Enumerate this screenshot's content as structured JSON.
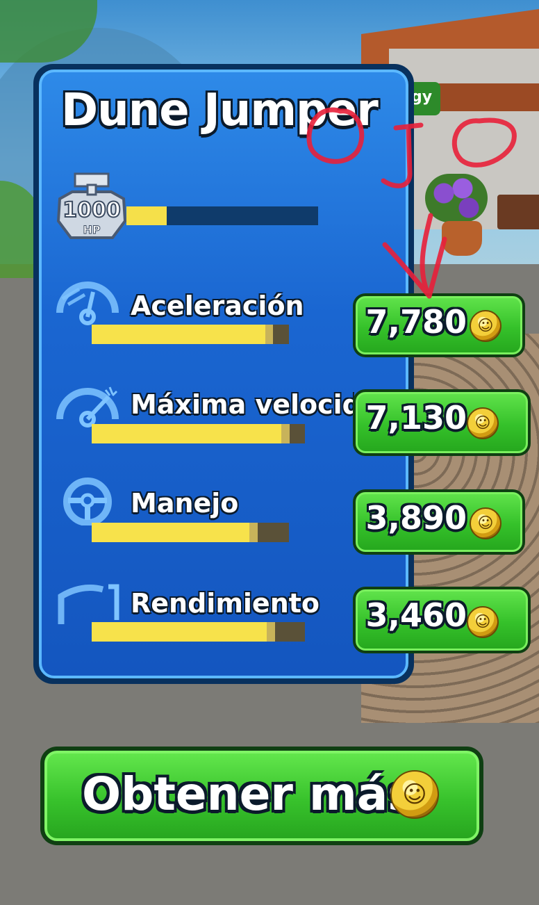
{
  "car": {
    "name": "Dune Jumper",
    "hp_badge": {
      "value": "1000",
      "unit": "HP"
    },
    "hp_progress": 0.21
  },
  "stats": [
    {
      "label": "Aceleración",
      "price": "7,780",
      "current": 0.88,
      "upgrade": 0.04
    },
    {
      "label": "Máxima velocidad",
      "price": "7,130",
      "current": 0.89,
      "upgrade": 0.04
    },
    {
      "label": "Manejo",
      "price": "3,890",
      "current": 0.8,
      "upgrade": 0.04
    },
    {
      "label": "Rendimiento",
      "price": "3,460",
      "current": 0.82,
      "upgrade": 0.04
    }
  ],
  "get_more": {
    "label": "Obtener más"
  },
  "background_badge": "gy",
  "colors": {
    "panel_blue": "#1a66d1",
    "bar_fill": "#f7e24b",
    "button_green": "#35c12a",
    "annotation_red": "#e8203a"
  },
  "icons": [
    "hp-badge-icon",
    "acceleration-icon",
    "top-speed-icon",
    "handling-icon",
    "performance-icon",
    "coin-icon"
  ]
}
